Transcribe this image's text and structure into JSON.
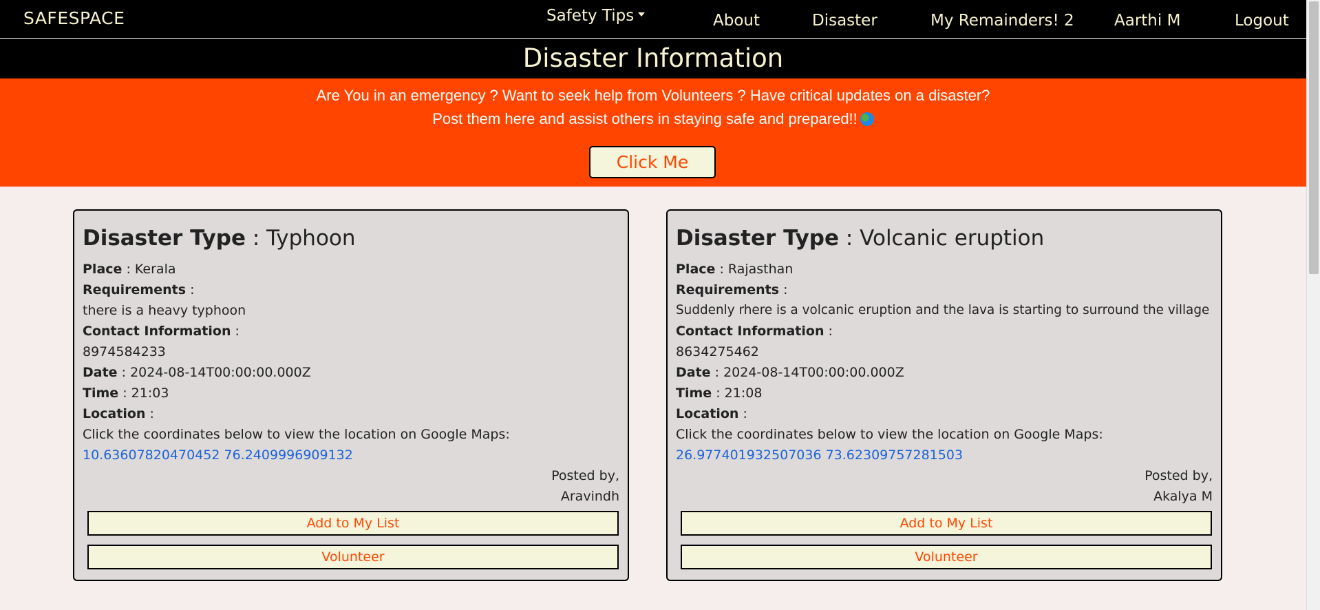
{
  "nav": {
    "brand": "SAFESPACE",
    "safety_tips": "Safety Tips",
    "about": "About",
    "disaster": "Disaster",
    "reminders": "My Remainders! 2",
    "user": "Aarthi M",
    "logout": "Logout"
  },
  "page_title": "Disaster Information",
  "banner": {
    "line1": "Are You in an emergency ? Want to seek help from Volunteers ? Have critical updates on a disaster?",
    "line2": "Post them here and assist others in staying safe and prepared!!",
    "button": "Click Me",
    "icon": "globe-icon"
  },
  "labels": {
    "disaster_type": "Disaster Type",
    "place": "Place",
    "requirements": "Requirements",
    "contact": "Contact Information",
    "date": "Date",
    "time": "Time",
    "location": "Location",
    "separator": ":",
    "maps_hint": "Click the coordinates below to view the location on Google Maps:",
    "posted_by": "Posted by,",
    "add_to_list": "Add to My List",
    "volunteer": "Volunteer"
  },
  "cards": [
    {
      "type": "Typhoon",
      "place": "Kerala",
      "requirements": "there is a heavy typhoon",
      "contact": "8974584233",
      "date": "2024-08-14T00:00:00.000Z",
      "time": "21:03",
      "coordinates": "10.63607820470452 76.2409996909132",
      "posted_by": "Aravindh"
    },
    {
      "type": "Volcanic eruption",
      "place": "Rajasthan",
      "requirements": "Suddenly rhere is a volcanic eruption and the lava is starting to surround the village",
      "contact": "8634275462",
      "date": "2024-08-14T00:00:00.000Z",
      "time": "21:08",
      "coordinates": "26.977401932507036 73.62309757281503",
      "posted_by": "Akalya M"
    }
  ],
  "colors": {
    "accent": "#ff4500",
    "nav_bg": "#000000",
    "nav_text": "#f7f3cf",
    "card_bg": "#dedada",
    "button_bg": "#f5f5dc",
    "link": "#1a63d8"
  }
}
